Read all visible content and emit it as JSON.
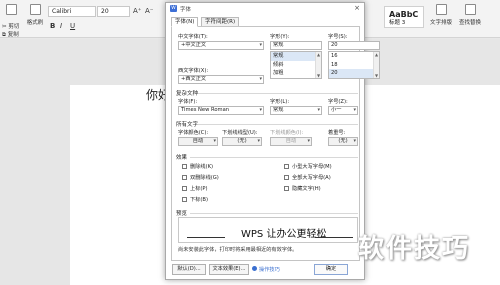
{
  "ribbon": {
    "cut_label": "剪切",
    "copy_label": "复制",
    "format_painter_label": "格式刷",
    "font_name": "Calibri",
    "font_size": "20",
    "grow_font": "A⁺",
    "shrink_font": "A⁻",
    "bold": "B",
    "italic": "I",
    "underline": "U",
    "style_preview": "AaBbC",
    "style_name": "标题 3",
    "text_layout_label": "文字排版",
    "find_replace_label": "查找替换"
  },
  "document": {
    "text": "你好"
  },
  "watermark": {
    "text": "软件技巧"
  },
  "dialog": {
    "title": "字体",
    "close": "×",
    "tabs": [
      "字体(N)",
      "字符间距(R)"
    ],
    "chinese_font": {
      "label": "中文字体(T):",
      "value": "+中文正文"
    },
    "font_style": {
      "label": "字形(Y):",
      "value": "常规",
      "options": [
        "常规",
        "倾斜",
        "加粗"
      ],
      "selected_index": 0
    },
    "font_size": {
      "label": "字号(S):",
      "value": "20",
      "options": [
        "16",
        "18",
        "20"
      ],
      "selected_index": 2
    },
    "western_font": {
      "label": "西文字体(X):",
      "value": "+西文正文"
    },
    "complex_section": "复杂文种",
    "complex_font": {
      "label": "字体(F):",
      "value": "Times New Roman"
    },
    "complex_style": {
      "label": "字形(L):",
      "value": "常规"
    },
    "complex_size": {
      "label": "字号(Z):",
      "value": "小一"
    },
    "all_text_section": "所有文字",
    "font_color": {
      "label": "字体颜色(C):",
      "value": "自动"
    },
    "underline_style": {
      "label": "下划线线型(U):",
      "value": "(无)"
    },
    "underline_color": {
      "label": "下划线颜色(I):",
      "value": "自动"
    },
    "emphasis": {
      "label": "着重号:",
      "value": "(无)"
    },
    "effects_section": "效果",
    "effects_left": [
      "删除线(K)",
      "双删除线(G)",
      "上标(P)",
      "下标(B)"
    ],
    "effects_right": [
      "小型大写字母(M)",
      "全部大写字母(A)",
      "隐藏文字(H)"
    ],
    "preview_section": "预览",
    "preview_text": "WPS 让办公更轻松",
    "preview_note": "尚未安装此字体，打印时将采用最相近的有效字体。",
    "buttons": {
      "default": "默认(D)...",
      "text_effects": "文本效果(E)...",
      "tips": "操作技巧",
      "ok": "确定"
    }
  }
}
